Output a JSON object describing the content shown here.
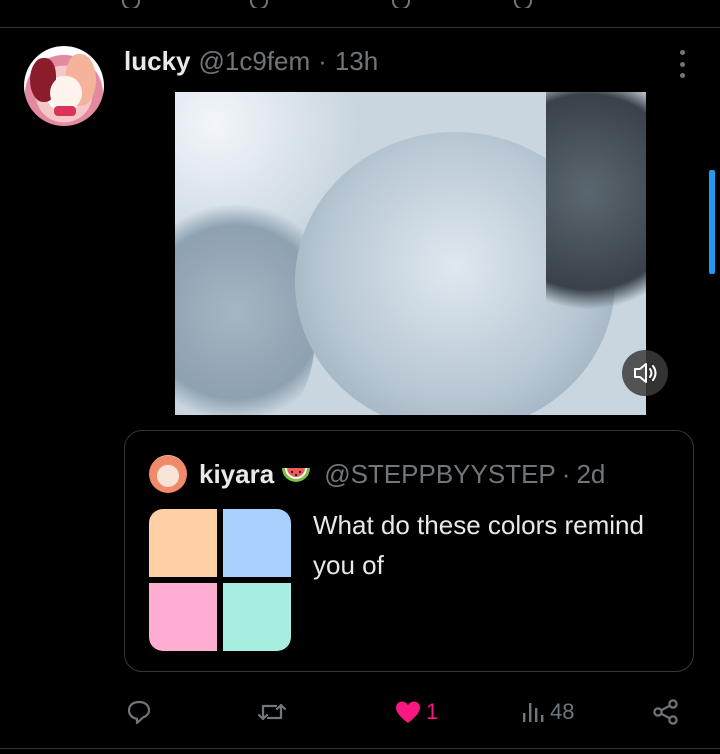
{
  "post": {
    "author_name": "lucky",
    "handle": "@1c9fem",
    "separator": "·",
    "time": "13h",
    "more_icon": "more-dots-icon",
    "mute_icon": "speaker-muted-icon"
  },
  "quote": {
    "author_name": "kiyara",
    "emoji": "watermelon-emoji",
    "handle": "@STEPPBYYSTEP",
    "separator": "·",
    "time": "2d",
    "text": "What do these colors remind you of",
    "swatch_colors": [
      "#ffcfa6",
      "#a9d1ff",
      "#ffaed2",
      "#a8eee0"
    ]
  },
  "actions": {
    "reply_icon": "reply-icon",
    "repost_icon": "repost-icon",
    "like_icon": "heart-filled-icon",
    "like_count": "1",
    "views_icon": "views-chart-icon",
    "views_count": "48",
    "share_icon": "share-icon"
  },
  "colors": {
    "background": "#000000",
    "text_primary": "#e7e9ea",
    "text_secondary": "#71767b",
    "like_accent": "#f91880",
    "border": "#2f3336",
    "scroll_indicator": "#1d9bf0"
  }
}
